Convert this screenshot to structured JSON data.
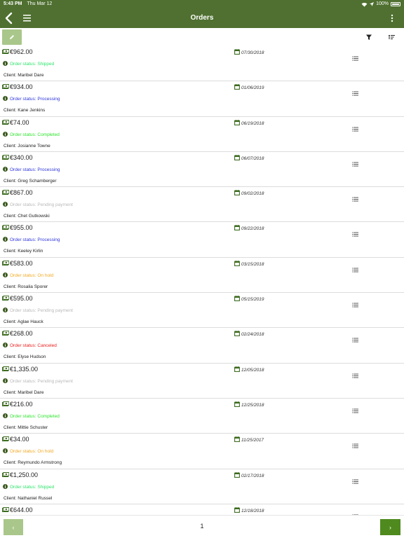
{
  "statusbar": {
    "time": "5:43 PM",
    "date": "Thu Mar 12",
    "battery": "100%"
  },
  "navbar": {
    "title": "Orders"
  },
  "colors": {
    "Shipped": "#2ee36a",
    "Processing": "#2e36d9",
    "Completed": "#2ee32e",
    "Pending payment": "#b9b9b9",
    "On hold": "#f2a922",
    "Canceled": "#ea1c1c"
  },
  "orders": [
    {
      "amount": "€962.00",
      "date": "07/30/2018",
      "status": "Order status: Shipped",
      "status_key": "Shipped",
      "client": "Client: Maribel Dare"
    },
    {
      "amount": "€934.00",
      "date": "01/06/2019",
      "status": "Order status: Processing",
      "status_key": "Processing",
      "client": "Client: Kane Jenkins"
    },
    {
      "amount": "€74.00",
      "date": "06/19/2018",
      "status": "Order status: Completed",
      "status_key": "Completed",
      "client": "Client: Josianne Towne"
    },
    {
      "amount": "€340.00",
      "date": "06/07/2018",
      "status": "Order status: Processing",
      "status_key": "Processing",
      "client": "Client: Greg Schamberger"
    },
    {
      "amount": "€867.00",
      "date": "09/02/2018",
      "status": "Order status: Pending payment",
      "status_key": "Pending payment",
      "client": "Client: Chet Gutkowski"
    },
    {
      "amount": "€955.00",
      "date": "09/22/2018",
      "status": "Order status: Processing",
      "status_key": "Processing",
      "client": "Client: Keeley Kirlin"
    },
    {
      "amount": "€583.00",
      "date": "03/15/2018",
      "status": "Order status: On hold",
      "status_key": "On hold",
      "client": "Client: Rosalia Sporer"
    },
    {
      "amount": "€595.00",
      "date": "05/15/2019",
      "status": "Order status: Pending payment",
      "status_key": "Pending payment",
      "client": "Client: Aglae Hauck"
    },
    {
      "amount": "€268.00",
      "date": "02/24/2018",
      "status": "Order status: Canceled",
      "status_key": "Canceled",
      "client": "Client: Elyse Hudson"
    },
    {
      "amount": "€1,335.00",
      "date": "12/05/2018",
      "status": "Order status: Pending payment",
      "status_key": "Pending payment",
      "client": "Client: Maribel Dare"
    },
    {
      "amount": "€216.00",
      "date": "12/25/2018",
      "status": "Order status: Completed",
      "status_key": "Completed",
      "client": "Client: Mittie Schuster"
    },
    {
      "amount": "€34.00",
      "date": "11/25/2017",
      "status": "Order status: On hold",
      "status_key": "On hold",
      "client": "Client: Reymundo Armstrong"
    },
    {
      "amount": "€1,250.00",
      "date": "02/17/2018",
      "status": "Order status: Shipped",
      "status_key": "Shipped",
      "client": "Client: Nathaniel Russel"
    },
    {
      "amount": "€644.00",
      "date": "12/18/2018",
      "status": "",
      "status_key": "",
      "client": ""
    }
  ],
  "pager": {
    "prev_label": "‹",
    "page": "1",
    "next_label": "›"
  }
}
